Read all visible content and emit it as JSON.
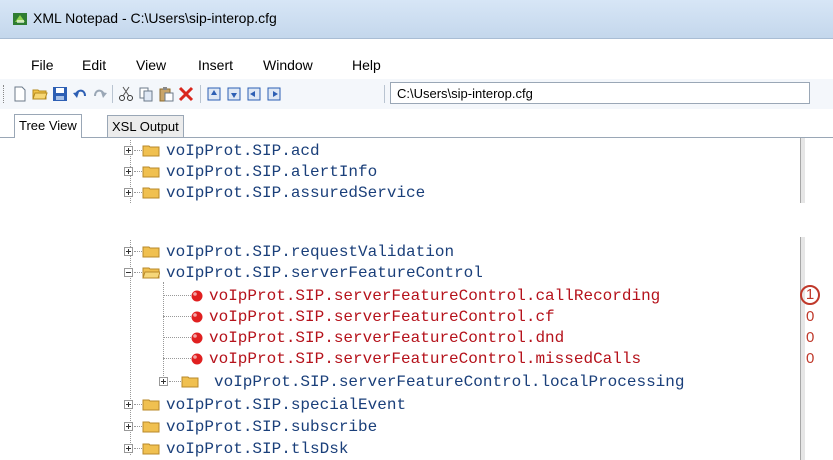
{
  "window": {
    "title": "XML Notepad - C:\\Users\\sip-interop.cfg"
  },
  "menu": [
    "File",
    "Edit",
    "View",
    "Insert",
    "Window",
    "Help"
  ],
  "toolbar": {
    "icons": [
      "new-file-icon",
      "open-folder-icon",
      "save-icon",
      "undo-icon",
      "redo-icon",
      "cut-icon",
      "copy-icon",
      "paste-icon",
      "delete-icon",
      "nudge-up-icon",
      "nudge-down-icon",
      "nudge-left-icon",
      "nudge-right-icon"
    ],
    "address": "C:\\Users\\sip-interop.cfg"
  },
  "tabs": [
    {
      "label": "Tree View",
      "active": true
    },
    {
      "label": "XSL Output",
      "active": false
    }
  ],
  "tree": {
    "top": [
      {
        "label": "voIpProt.SIP.acd",
        "expanded": false
      },
      {
        "label": "voIpProt.SIP.alertInfo",
        "expanded": false
      },
      {
        "label": "voIpProt.SIP.assuredService",
        "expanded": false
      }
    ],
    "bottom": [
      {
        "label": "voIpProt.SIP.requestValidation",
        "expanded": false
      },
      {
        "label": "voIpProt.SIP.serverFeatureControl",
        "expanded": true
      },
      {
        "label": "voIpProt.SIP.serverFeatureControl.callRecording",
        "value": "1",
        "circled": true
      },
      {
        "label": "voIpProt.SIP.serverFeatureControl.cf",
        "value": "0"
      },
      {
        "label": "voIpProt.SIP.serverFeatureControl.dnd",
        "value": "0"
      },
      {
        "label": "voIpProt.SIP.serverFeatureControl.missedCalls",
        "value": "0"
      },
      {
        "label": "voIpProt.SIP.serverFeatureControl.localProcessing",
        "expanded": false
      },
      {
        "label": "voIpProt.SIP.specialEvent",
        "expanded": false
      },
      {
        "label": "voIpProt.SIP.subscribe",
        "expanded": false
      },
      {
        "label": "voIpProt.SIP.tlsDsk",
        "expanded": false
      }
    ]
  },
  "colors": {
    "folder_text": "#1a3f7a",
    "leaf_text": "#b5121b",
    "value_text": "#c0392b"
  }
}
